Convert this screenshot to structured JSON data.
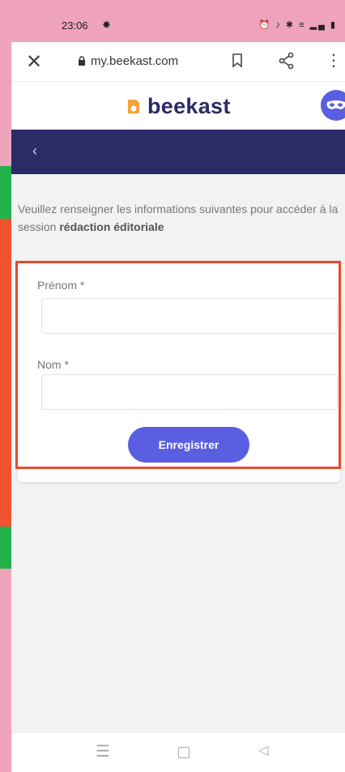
{
  "status_bar": {
    "time": "23:06",
    "notification_icon": "bug-icon",
    "right_icons": "⏰ ♪ ✱ ≡ ▂▄ ▮"
  },
  "browser": {
    "url": "my.beekast.com",
    "close_icon": "close-icon",
    "lock_icon": "lock-icon",
    "bookmark_icon": "bookmark-icon",
    "share_icon": "share-icon",
    "more_icon": "more-vertical-icon"
  },
  "header": {
    "brand": "beekast",
    "avatar_icon": "mask-avatar-icon"
  },
  "nav": {
    "back": "‹"
  },
  "intro": {
    "text_before": "Veuillez renseigner les informations suivantes pour accéder à la session ",
    "session_name": "rédaction éditoriale"
  },
  "form": {
    "first_name_label": "Prénom *",
    "first_name_value": "",
    "last_name_label": "Nom *",
    "last_name_value": "",
    "submit_label": "Enregistrer"
  },
  "colors": {
    "accent": "#5a5ee0",
    "brand_dark": "#2b2b66",
    "highlight": "#e84a2a"
  }
}
